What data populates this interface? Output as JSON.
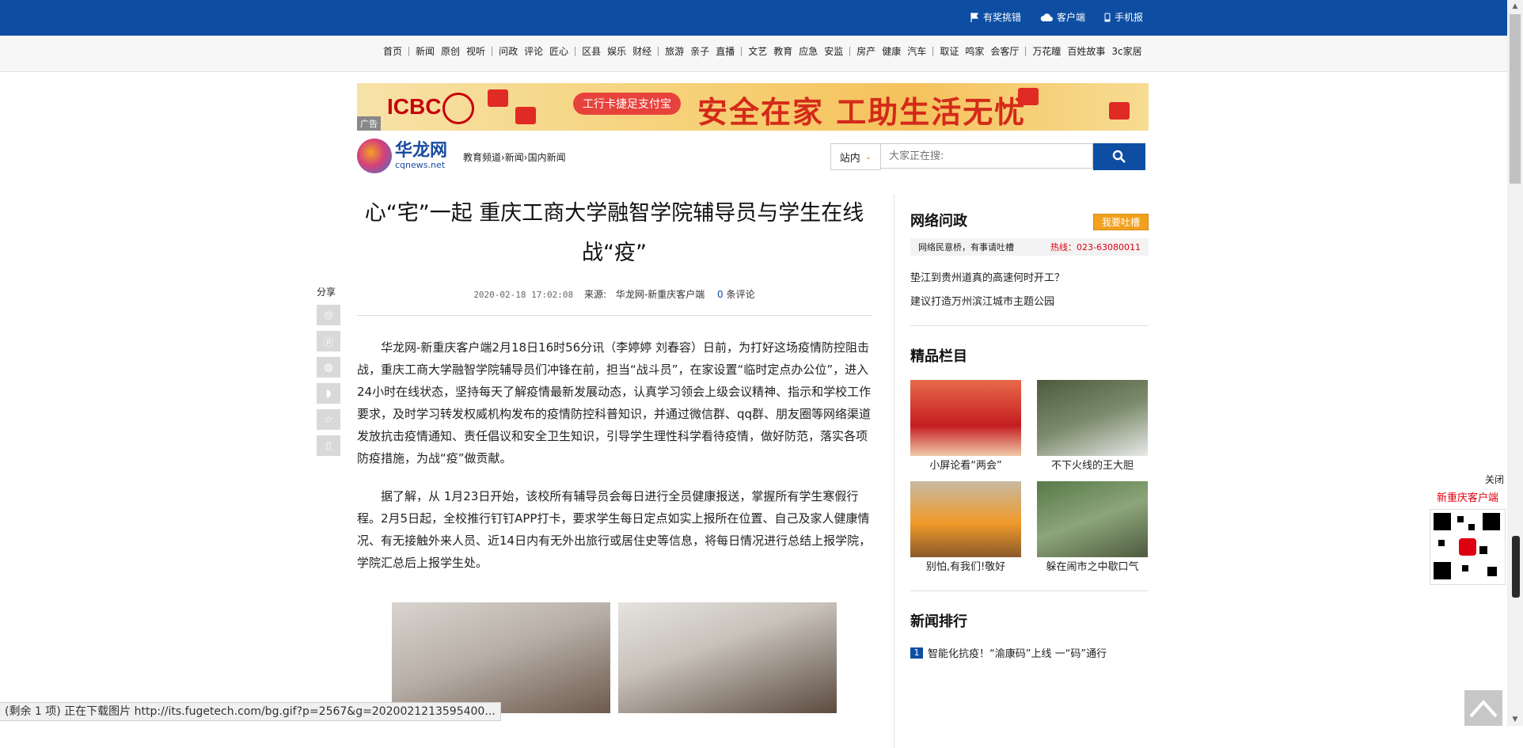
{
  "topbar": {
    "links": [
      "有奖挑错",
      "客户端",
      "手机报"
    ]
  },
  "nav": {
    "groups": [
      [
        "首页"
      ],
      [
        "新闻",
        "原创",
        "视听"
      ],
      [
        "问政",
        "评论",
        "匠心"
      ],
      [
        "区县",
        "娱乐",
        "财经"
      ],
      [
        "旅游",
        "亲子",
        "直播"
      ],
      [
        "文艺",
        "教育",
        "应急",
        "安监"
      ],
      [
        "房产",
        "健康",
        "汽车"
      ],
      [
        "取证",
        "鸣家",
        "会客厅"
      ],
      [
        "万花瞳",
        "百姓故事",
        "3c家居"
      ]
    ]
  },
  "ad": {
    "brand": "ICBC",
    "pill": "工行卡捷足支付宝",
    "slogan": "安全在家 工助生活无忧",
    "tag": "广告"
  },
  "header": {
    "logo_cn": "华龙网",
    "logo_en": "cqnews.net",
    "breadcrumb": "教育频道›新闻›国内新闻",
    "search_scope": "站内",
    "search_placeholder": "大家正在搜:"
  },
  "share": {
    "label": "分享",
    "icons": [
      "weibo-icon",
      "pinterest-icon",
      "wechat-icon",
      "qq-icon",
      "star-icon",
      "phone-icon"
    ]
  },
  "article": {
    "title": "心“宅”一起 重庆工商大学融智学院辅导员与学生在线战“疫”",
    "date": "2020-02-18 17:02:08",
    "source_label": "来源:",
    "source": "华龙网-新重庆客户端",
    "comment_count": "0",
    "comment_label": "条评论",
    "paragraphs": [
      "华龙网-新重庆客户端2月18日16时56分讯（李婷婷 刘春容）日前，为打好这场疫情防控阻击战，重庆工商大学融智学院辅导员们冲锋在前，担当“战斗员”，在家设置“临时定点办公位”，进入24小时在线状态，坚持每天了解疫情最新发展动态，认真学习领会上级会议精神、指示和学校工作要求，及时学习转发权威机构发布的疫情防控科普知识，并通过微信群、qq群、朋友圈等网络渠道发放抗击疫情通知、责任倡议和安全卫生知识，引导学生理性科学看待疫情，做好防范，落实各项防疫措施，为战“疫”做贡献。",
      "据了解，从 1月23日开始，该校所有辅导员会每日进行全员健康报送，掌握所有学生寒假行程。2月5日起，全校推行钉钉APP打卡，要求学生每日定点如实上报所在位置、自己及家人健康情况、有无接触外来人员、近14日内有无外出旅行或居住史等信息，将每日情况进行总结上报学院，学院汇总后上报学生处。"
    ]
  },
  "sidebar": {
    "wenzheng": {
      "title": "网络问政",
      "button": "我要吐槽",
      "notice": "网络民意桥，有事请吐槽",
      "hotline": "热线：023-63080011",
      "questions": [
        "垫江到贵州道真的高速何时开工？",
        "建议打造万州滨江城市主题公园"
      ]
    },
    "jingpin": {
      "title": "精品栏目",
      "items": [
        "小屏论看“两会”",
        "不下火线的王大胆",
        "别怕,有我们!敬好",
        "躲在闹市之中歇口气"
      ]
    },
    "ranking": {
      "title": "新闻排行",
      "items": [
        {
          "num": "1",
          "text": "智能化抗疫！“渝康码”上线 一“码”通行"
        }
      ]
    }
  },
  "float_ad": {
    "close": "关闭",
    "app": "新重庆客户端"
  },
  "status_bar": "(剩余 1 项) 正在下载图片 http://its.fugetech.com/bg.gif?p=2567&g=2020021213595400..."
}
